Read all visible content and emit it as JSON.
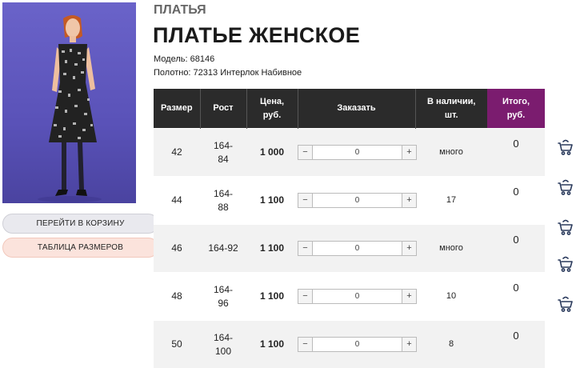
{
  "product": {
    "category": "ПЛАТЬЯ",
    "title": "ПЛАТЬЕ ЖЕНСКОЕ",
    "model_line": "Модель: 68146",
    "fabric_line": "Полотно: 72313 Интерлок Набивное"
  },
  "buttons": {
    "cart_label": "ПЕРЕЙТИ В КОРЗИНУ",
    "sizes_label": "ТАБЛИЦА РАЗМЕРОВ"
  },
  "table": {
    "headers": {
      "size": "Размер",
      "height": "Рост",
      "price_1": "Цена,",
      "price_2": "руб.",
      "order": "Заказать",
      "stock_1": "В наличии,",
      "stock_2": "шт.",
      "total_1": "Итого,",
      "total_2": "руб."
    },
    "stepper_minus": "−",
    "stepper_plus": "+",
    "rows": [
      {
        "size": "42",
        "height_1": "164-",
        "height_2": "84",
        "price": "1 000",
        "qty": "0",
        "stock": "много",
        "total": "0"
      },
      {
        "size": "44",
        "height_1": "164-",
        "height_2": "88",
        "price": "1 100",
        "qty": "0",
        "stock": "17",
        "total": "0"
      },
      {
        "size": "46",
        "height_1": "164-92",
        "height_2": "",
        "price": "1 100",
        "qty": "0",
        "stock": "много",
        "total": "0"
      },
      {
        "size": "48",
        "height_1": "164-",
        "height_2": "96",
        "price": "1 100",
        "qty": "0",
        "stock": "10",
        "total": "0"
      },
      {
        "size": "50",
        "height_1": "164-",
        "height_2": "100",
        "price": "1 100",
        "qty": "0",
        "stock": "8",
        "total": "0"
      }
    ]
  },
  "colors": {
    "header_bg": "#2b2b2b",
    "total_header_bg": "#7b1c6f",
    "icon_color": "#2a3a5c",
    "photo_bg": "#5a52b8"
  },
  "icons": {
    "row_action": "cart-icon"
  }
}
